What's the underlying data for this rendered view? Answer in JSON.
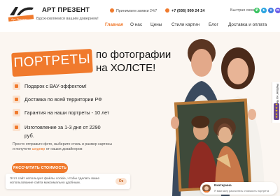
{
  "header": {
    "brand_name": "АРТ ПРЕЗЕНТ",
    "slogan": "Вдохновляемся вашим доверием!",
    "logo_text": "Арт Презент",
    "hours": "Принимаем заявки 24/7",
    "phone": "+7 (936) 999 24 24",
    "messengers_label": "Быстрая связь:",
    "messenger_icons": [
      "whatsapp-icon",
      "telegram-icon",
      "vk-icon",
      "max-icon"
    ],
    "nav": [
      "Главная",
      "О нас",
      "Цены",
      "Стили картин",
      "Блог",
      "Доставка и оплата"
    ],
    "accent_color": "#f07a2d"
  },
  "hero": {
    "badge": "ПОРТРЕТЫ",
    "line1": "по фотографии",
    "line2": "на ХОЛСТЕ!",
    "benefits": [
      "Подарок с ВАУ-эффектом!",
      "Доставка по всей территории РФ",
      "Гарантия на наши портреты - 10 лет",
      "Изготовление за 1-3 дня от 2290",
      "руб."
    ],
    "desc_line1": "Просто отправьте фото, выберите стиль и размер картины",
    "desc_line2_pre": "и получите ",
    "desc_line2_hl": "шедевр",
    "desc_line2_post": " от наших дизайнеров",
    "cta": "РАССЧИТАТЬ СТОИМОСТЬ"
  },
  "rating_widget": {
    "label": "Рейтинг на Яндексе 5.0",
    "stars": 5
  },
  "cookie": {
    "line1": "Этот сайт использует файлы cookie, чтобы сделать ваше",
    "line2": "использование сайта максимально удобным.",
    "ok": "Ок"
  },
  "chat": {
    "name": "Екатерина",
    "message": "Я вам могу рассчитать стоимость портрета"
  }
}
